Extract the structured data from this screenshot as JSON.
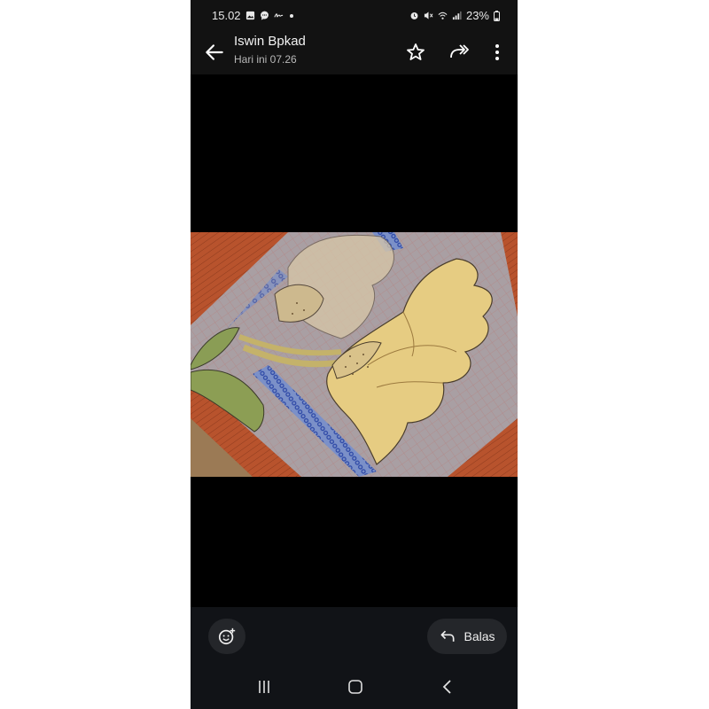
{
  "status_bar": {
    "time": "15.02",
    "battery": "23%",
    "left_icons": [
      "gallery-icon",
      "chat-icon",
      "signature-icon",
      "dot-icon"
    ],
    "right_icons": [
      "alarm-icon",
      "mute-icon",
      "wifi-icon",
      "signal-icon",
      "battery-icon"
    ]
  },
  "header": {
    "sender": "Iswin Bpkad",
    "timestamp": "Hari ini 07.26",
    "actions": [
      "star-icon",
      "forward-icon",
      "more-icon"
    ]
  },
  "media": {
    "description_icon": "photo-image"
  },
  "footer": {
    "emoji_icon": "emoji-add-icon",
    "reply_label": "Balas"
  },
  "nav_bar": [
    "recents-icon",
    "home-icon",
    "back-icon"
  ],
  "colors": {
    "bar_bg": "#121212",
    "button_bg": "#24262a",
    "text_primary": "#f2f2f2",
    "text_secondary": "#b8b8b8"
  }
}
